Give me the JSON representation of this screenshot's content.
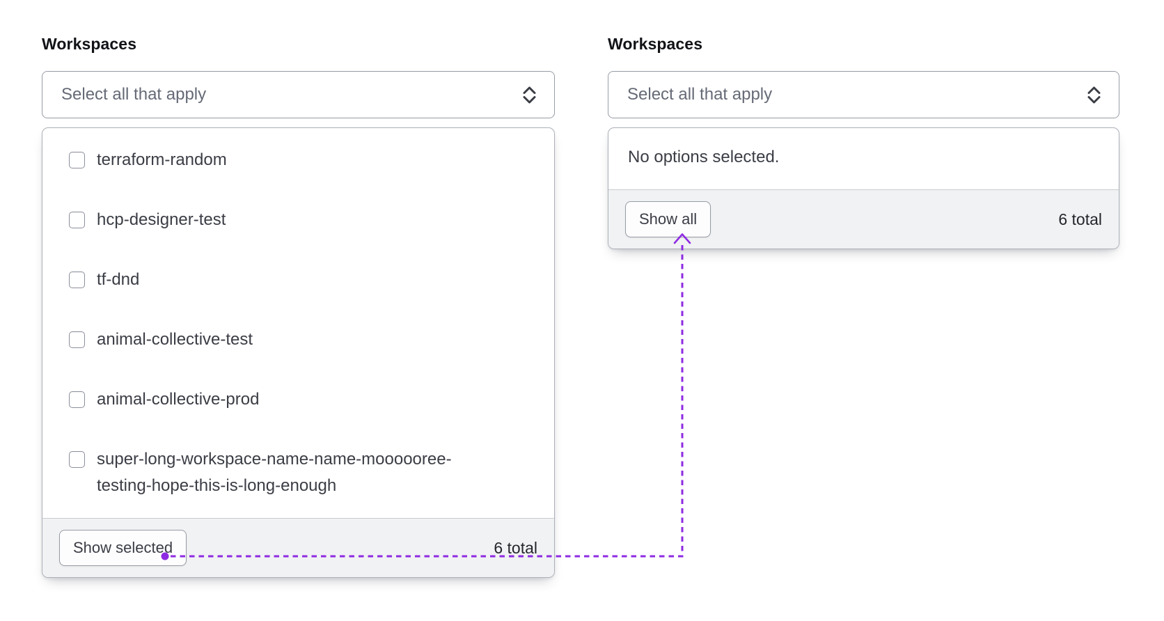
{
  "left": {
    "label": "Workspaces",
    "placeholder": "Select all that apply",
    "options": [
      "terraform-random",
      "hcp-designer-test",
      "tf-dnd",
      "animal-collective-test",
      "animal-collective-prod",
      "super-long-workspace-name-name-moooooree-testing-hope-this-is-long-enough"
    ],
    "footer": {
      "button": "Show selected",
      "total": "6 total"
    }
  },
  "right": {
    "label": "Workspaces",
    "placeholder": "Select all that apply",
    "empty_message": "No options selected.",
    "footer": {
      "button": "Show all",
      "total": "6 total"
    }
  },
  "colors": {
    "annotation_purple": "#8e2be2",
    "footer_background": "#f1f2f3",
    "control_border": "#969ca5",
    "panel_border": "#acb0b8",
    "text_primary": "#3b3d45",
    "placeholder_text": "#656a76"
  }
}
